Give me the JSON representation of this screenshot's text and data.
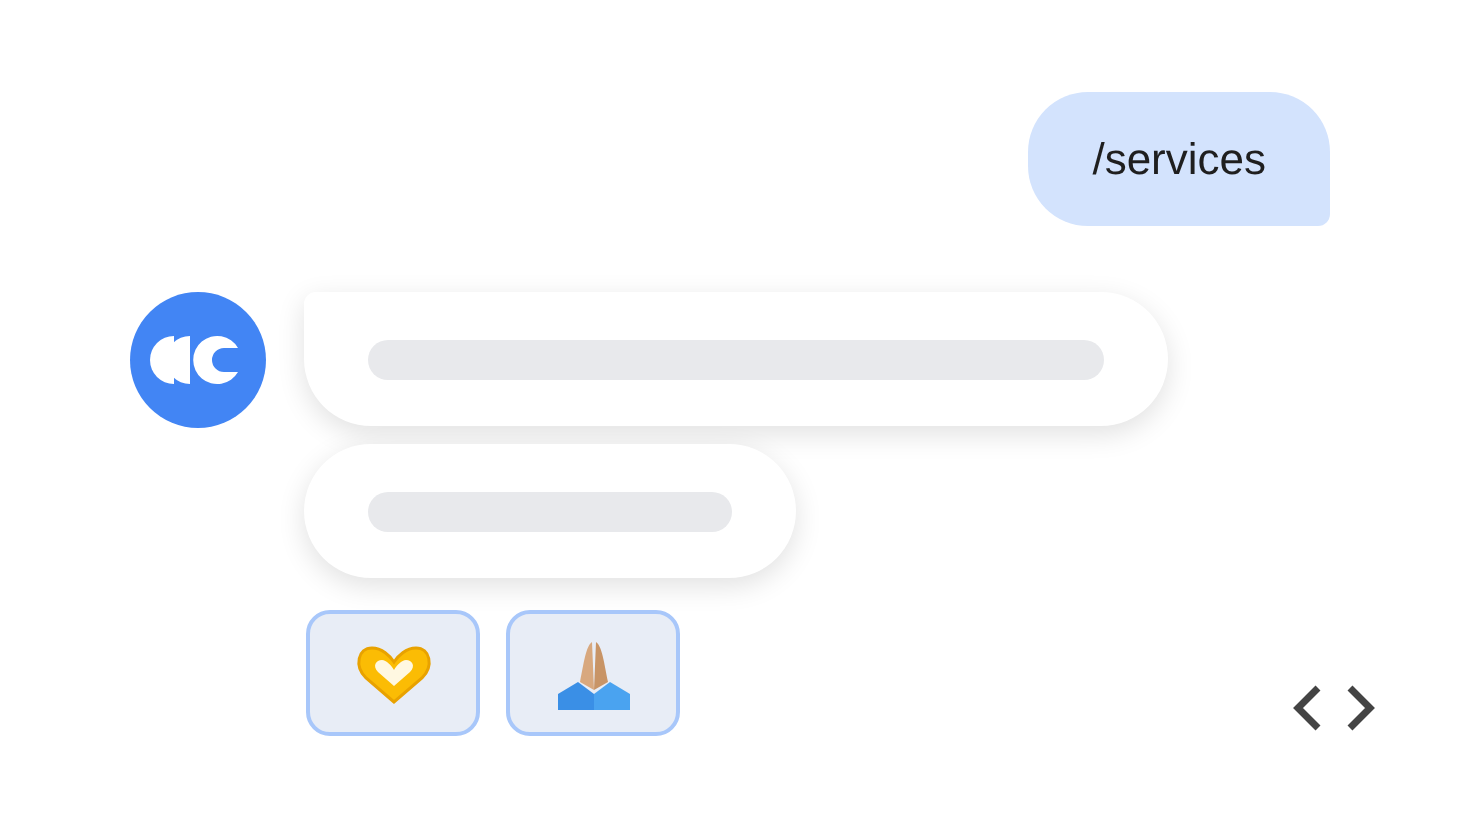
{
  "user_message": {
    "text": "/services"
  },
  "bot_reply": {
    "loading": true,
    "skeleton_bubbles": [
      {
        "wide": true
      },
      {
        "wide": false
      }
    ]
  },
  "reactions": [
    {
      "kind": "heart-hands"
    },
    {
      "kind": "praying-hands"
    }
  ],
  "code_toggle": {
    "kind": "code"
  }
}
